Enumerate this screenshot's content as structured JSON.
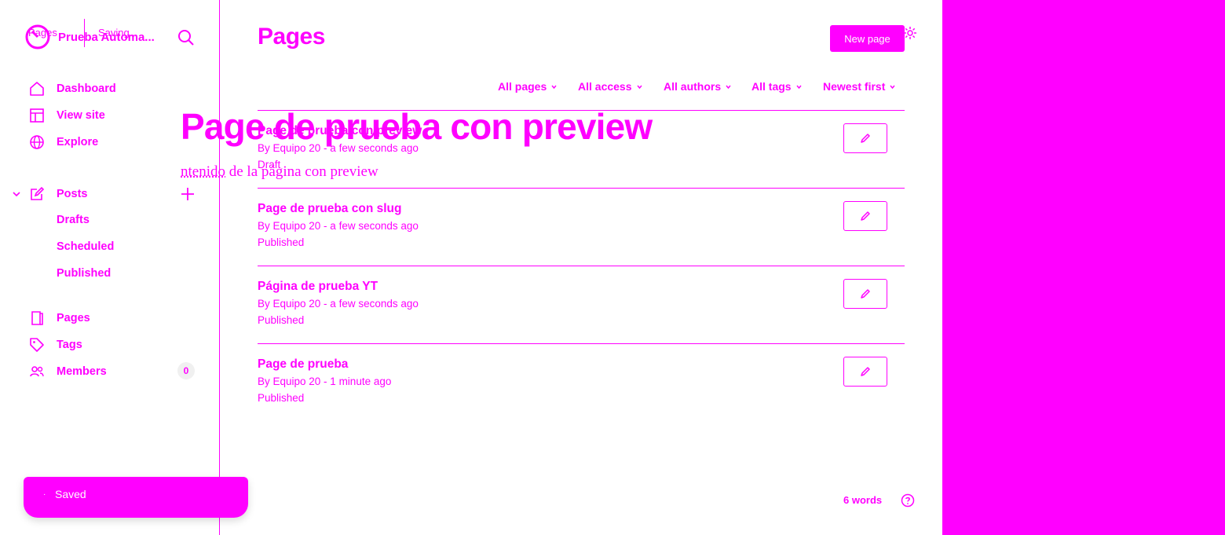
{
  "colors": {
    "accent": "#ff00ff",
    "background": "#ffffff",
    "badge_bg": "#f0f0f0"
  },
  "site": {
    "title": "Prueba Automa..."
  },
  "editor_bar": {
    "back_label": "Pages",
    "status": "Saving..."
  },
  "sidebar": {
    "items": [
      {
        "label": "Dashboard",
        "icon": "home-icon"
      },
      {
        "label": "View site",
        "icon": "layout-icon"
      },
      {
        "label": "Explore",
        "icon": "globe-icon"
      },
      {
        "label": "Posts",
        "icon": "edit-icon"
      },
      {
        "label": "Pages",
        "icon": "page-icon"
      },
      {
        "label": "Tags",
        "icon": "tag-icon"
      },
      {
        "label": "Members",
        "icon": "members-icon"
      }
    ],
    "post_subitems": [
      "Drafts",
      "Scheduled",
      "Published"
    ],
    "members_count": "0"
  },
  "toast": {
    "label": "Saved"
  },
  "main": {
    "title": "Pages",
    "new_button": "New page",
    "filters": [
      "All pages",
      "All access",
      "All authors",
      "All tags",
      "Newest first"
    ],
    "rows": [
      {
        "title": "Page de prueba con preview",
        "meta": "By Equipo 20 - a few seconds ago",
        "status": "Draft"
      },
      {
        "title": "Page de prueba con slug",
        "meta": "By Equipo 20 - a few seconds ago",
        "status": "Published"
      },
      {
        "title": "Página de prueba YT",
        "meta": "By Equipo 20 - a few seconds ago",
        "status": "Published"
      },
      {
        "title": "Page de prueba",
        "meta": "By Equipo 20 - 1 minute ago",
        "status": "Published"
      }
    ]
  },
  "overlay": {
    "title": "Page de prueba con preview",
    "body_prefix": "ntenido",
    "body_rest": " de la página con preview"
  },
  "footer": {
    "word_count": "6 words"
  }
}
